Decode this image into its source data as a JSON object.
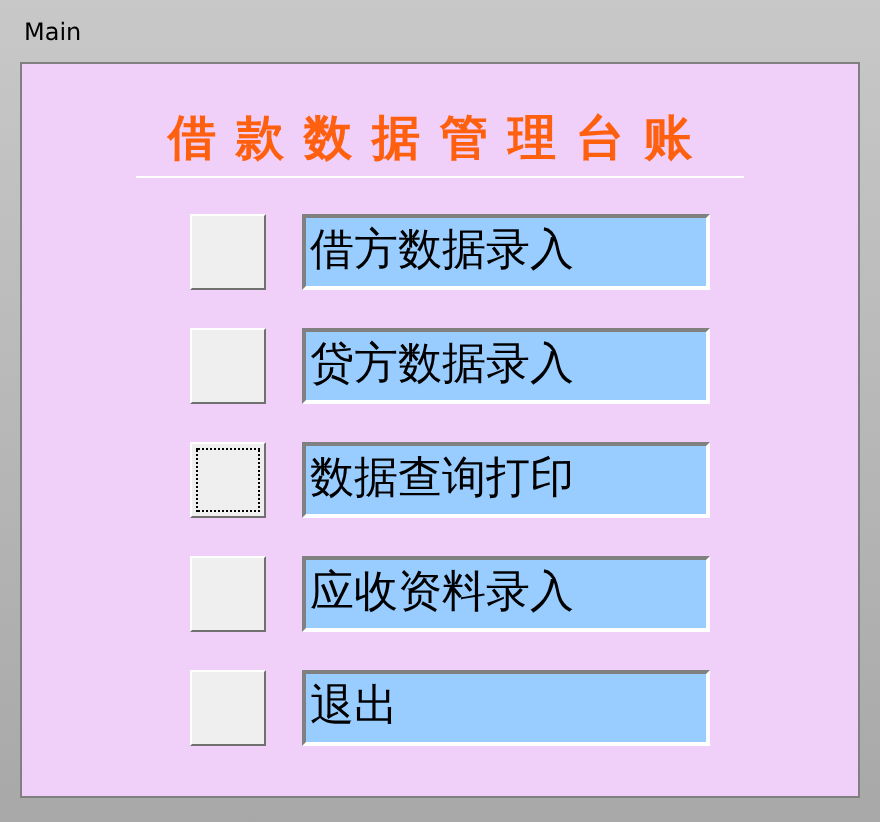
{
  "window": {
    "title": "Main"
  },
  "heading": "借款数据管理台账",
  "menu": [
    {
      "label": "借方数据录入",
      "focused": false
    },
    {
      "label": "贷方数据录入",
      "focused": false
    },
    {
      "label": "数据查询打印",
      "focused": true
    },
    {
      "label": "应收资料录入",
      "focused": false
    },
    {
      "label": "退出",
      "focused": false
    }
  ]
}
